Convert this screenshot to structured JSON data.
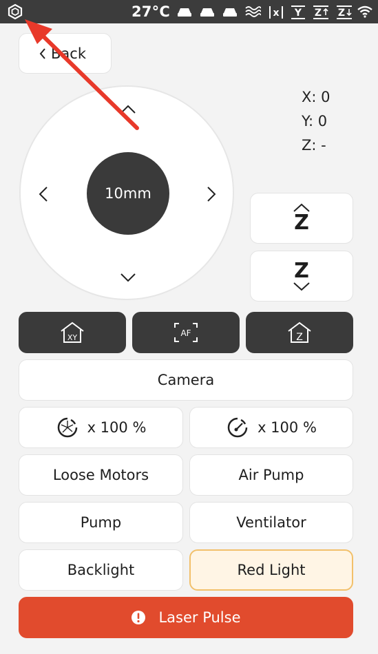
{
  "status_bar": {
    "temperature": "27°C",
    "icons": [
      "bed-heat-icon",
      "bed-heat-icon",
      "bed-heat-icon",
      "heat-wave-icon",
      "x-axis-icon",
      "y-home-icon",
      "z-up-icon",
      "z-down-icon",
      "wifi-icon"
    ]
  },
  "back_button": {
    "label": "Back"
  },
  "jog": {
    "step": "10mm"
  },
  "coordinates": {
    "x": "X: 0",
    "y": "Y: 0",
    "z": "Z: -"
  },
  "z_buttons": {
    "up_label": "Z",
    "down_label": "Z"
  },
  "home_buttons": {
    "xy": "XY",
    "af": "AF",
    "z": "Z"
  },
  "camera": {
    "label": "Camera"
  },
  "speed_factor": {
    "label": "x 100 %"
  },
  "flow_factor": {
    "label": "x 100 %"
  },
  "controls": {
    "loose_motors": "Loose Motors",
    "air_pump": "Air Pump",
    "pump": "Pump",
    "ventilator": "Ventilator",
    "backlight": "Backlight",
    "red_light": "Red Light"
  },
  "laser_pulse": {
    "label": "Laser Pulse"
  },
  "colors": {
    "accent_red": "#e14b2d",
    "highlight": "#fff5e5",
    "dark": "#3a3a3a"
  }
}
